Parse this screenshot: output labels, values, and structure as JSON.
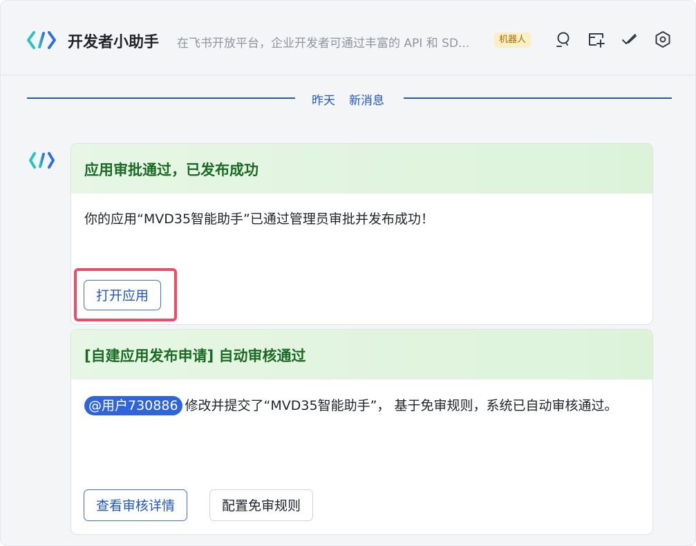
{
  "header": {
    "title": "开发者小助手",
    "description": "在飞书开放平台，企业开发者可通过丰富的 API 和 SD...",
    "badge": "机器人",
    "icons": [
      "search-icon",
      "add-tab-icon",
      "check-icon",
      "gear-icon"
    ]
  },
  "divider": {
    "date": "昨天",
    "new_label": "新消息"
  },
  "messages": [
    {
      "title": "应用审批通过，已发布成功",
      "body": "你的应用“MVD35智能助手”已通过管理员审批并发布成功！",
      "buttons": [
        "打开应用"
      ]
    },
    {
      "title": "[自建应用发布申请] 自动审核通过",
      "mention": "@用户730886",
      "body": "修改并提交了“MVD35智能助手”， 基于免审规则，系统已自动审核通过。",
      "buttons": [
        "查看审核详情",
        "配置免审规则"
      ]
    }
  ],
  "colors": {
    "accent": "#1f55c9",
    "success_title": "#1a6a24",
    "highlight": "#f04b63",
    "badge_bg": "#fbefc6"
  }
}
